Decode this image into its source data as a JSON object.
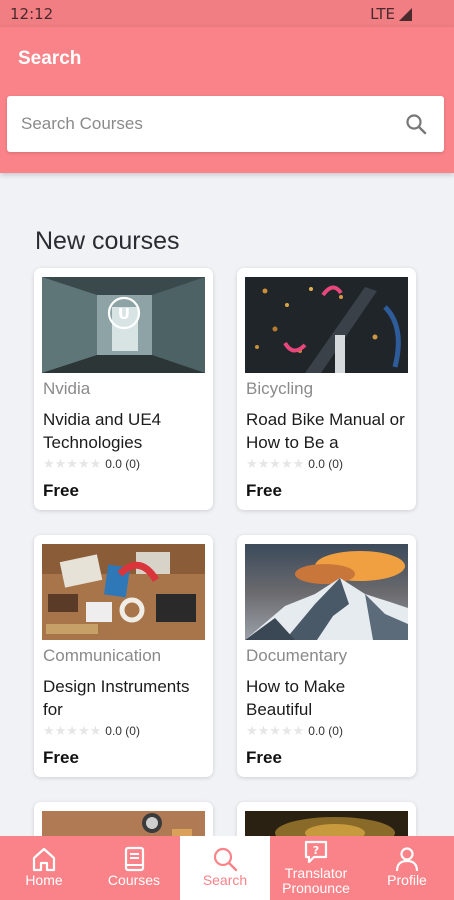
{
  "status_bar": {
    "time": "12:12",
    "network": "LTE"
  },
  "header": {
    "title": "Search"
  },
  "search": {
    "placeholder": "Search Courses",
    "value": ""
  },
  "section": {
    "title": "New courses"
  },
  "courses": [
    {
      "category": "Nvidia",
      "title": "Nvidia and UE4 Technologies",
      "rating": "0.0 (0)",
      "stars": 0,
      "price": "Free"
    },
    {
      "category": "Bicycling",
      "title": "Road Bike Manual or How to Be a",
      "rating": "0.0 (0)",
      "stars": 0,
      "price": "Free"
    },
    {
      "category": "Communication",
      "title": "Design Instruments for",
      "rating": "0.0 (0)",
      "stars": 0,
      "price": "Free"
    },
    {
      "category": "Documentary",
      "title": "How to Make Beautiful",
      "rating": "0.0 (0)",
      "stars": 0,
      "price": "Free"
    }
  ],
  "nav": {
    "home": "Home",
    "courses": "Courses",
    "search": "Search",
    "translator": "Translator Pronounce",
    "profile": "Profile"
  },
  "colors": {
    "primary": "#f98388",
    "status_bar": "#f07e83",
    "background": "#f1f2f6"
  }
}
